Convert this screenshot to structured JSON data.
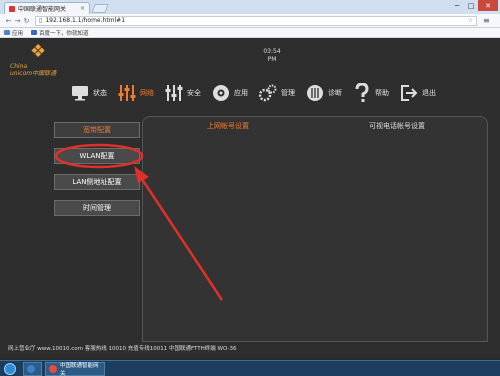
{
  "browser": {
    "tab_title": "中国联通智能网关",
    "tab_close": "×",
    "new_tab": "",
    "window_controls": {
      "minimize": "─",
      "maximize": "□",
      "close": "✕"
    },
    "back_label": "←",
    "forward_label": "→",
    "reload_label": "↻",
    "url_prefix": "▯",
    "url": "192.168.1.1/home.html#1",
    "star": "☆",
    "menu": "≡",
    "bookmarks": [
      {
        "label": "应用",
        "color": "#4a86c8"
      },
      {
        "label": "百度一下，你就知道",
        "color": "#3a66c4"
      }
    ]
  },
  "header": {
    "brand_line1": "China",
    "brand_line2": "unicom中国联通",
    "clock_time": "03:54",
    "clock_ampm": "PM"
  },
  "nav": {
    "items": [
      {
        "label": "状态",
        "icon": "monitor-icon",
        "active": false
      },
      {
        "label": "网络",
        "icon": "sliders-icon",
        "active": true
      },
      {
        "label": "安全",
        "icon": "sliders-icon",
        "active": false
      },
      {
        "label": "应用",
        "icon": "gear-circle-icon",
        "active": false
      },
      {
        "label": "管理",
        "icon": "gears-icon",
        "active": false
      },
      {
        "label": "诊断",
        "icon": "grid-circle-icon",
        "active": false
      },
      {
        "label": "帮助",
        "icon": "question-icon",
        "active": false
      },
      {
        "label": "退出",
        "icon": "logout-icon",
        "active": false
      }
    ]
  },
  "sidebar": {
    "items": [
      {
        "label": "宽带配置",
        "active": true
      },
      {
        "label": "WLAN配置",
        "active": false
      },
      {
        "label": "LAN侧地址配置",
        "active": false
      },
      {
        "label": "时间管理",
        "active": false
      }
    ]
  },
  "content": {
    "tabs": [
      {
        "label": "上网帐号设置",
        "active": true
      },
      {
        "label": "可视电话帐号设置",
        "active": false
      }
    ]
  },
  "footer": {
    "text": "网上营业厅 www.10010.com 客服热线 10010 充值专线10011 中国联通FTTH终端 WO-36"
  },
  "taskbar": {
    "buttons": [
      {
        "label": "",
        "color": "#3b82c4"
      },
      {
        "label": "中国联通智能网关",
        "color": "#e64b3c"
      }
    ],
    "tray": ""
  },
  "annotation": {
    "color": "#e0302a"
  }
}
